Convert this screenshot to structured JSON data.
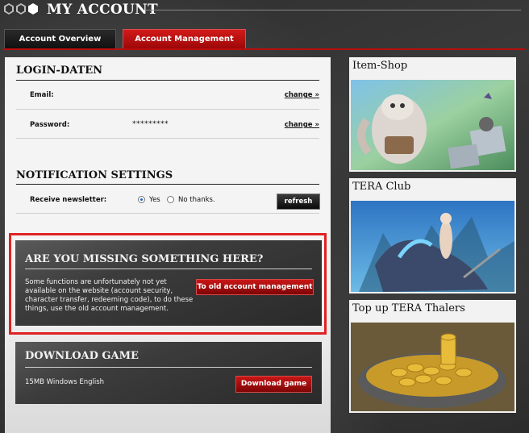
{
  "header": {
    "title": "MY ACCOUNT"
  },
  "tabs": [
    {
      "label": "Account Overview"
    },
    {
      "label": "Account Management"
    }
  ],
  "login": {
    "heading": "LOGIN-DATEN",
    "email_label": "Email:",
    "email_change": "change »",
    "password_label": "Password:",
    "password_value": "*********",
    "password_change": "change »"
  },
  "notifications": {
    "heading": "NOTIFICATION SETTINGS",
    "newsletter_label": "Receive newsletter:",
    "option_yes": "Yes",
    "option_no": "No thanks.",
    "refresh_label": "refresh"
  },
  "missing": {
    "heading": "ARE YOU MISSING SOMETHING HERE?",
    "text": "Some functions are unfortunately not yet available on the website (account security, character transfer, redeeming code), to do these things, use the old account management.",
    "button_label": "To old account management"
  },
  "download": {
    "heading": "DOWNLOAD GAME",
    "info": "15MB Windows English",
    "button_label": "Download game"
  },
  "sidebar": [
    {
      "title": "Item-Shop"
    },
    {
      "title": "TERA Club"
    },
    {
      "title": "Top up TERA Thalers"
    }
  ],
  "colors": {
    "accent_red": "#b80d0d",
    "highlight_red": "#e02222"
  }
}
